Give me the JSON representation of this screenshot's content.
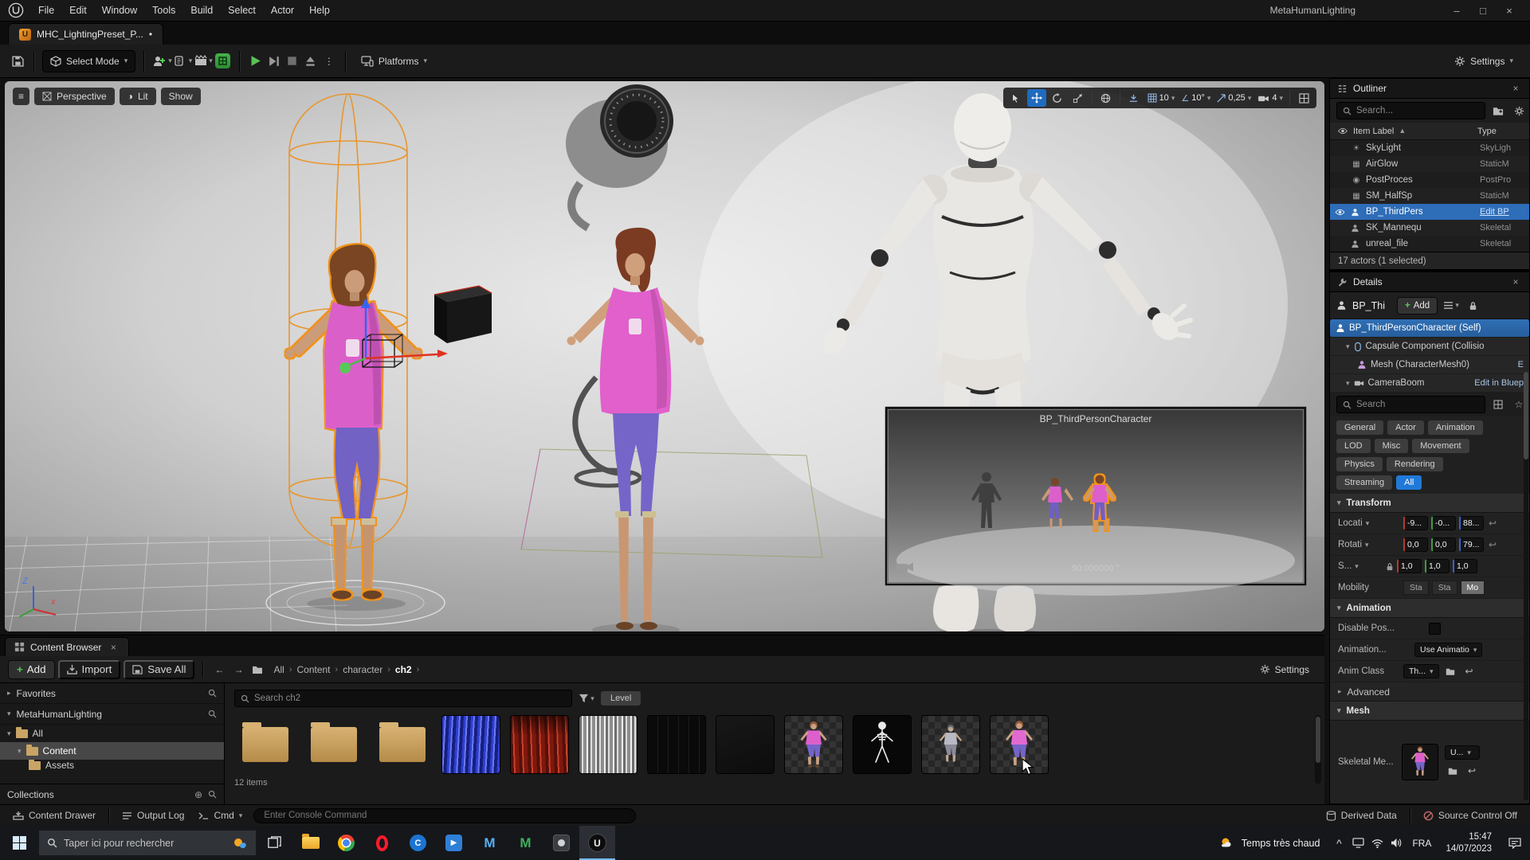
{
  "menubar": {
    "menus": [
      "File",
      "Edit",
      "Window",
      "Tools",
      "Build",
      "Select",
      "Actor",
      "Help"
    ],
    "window_title": "MetaHumanLighting",
    "minimize": "–",
    "maximize": "□",
    "close": "×"
  },
  "asset_tab": {
    "label": "MHC_LightingPreset_P...",
    "dirty": "•"
  },
  "toolbar": {
    "select_mode": "Select Mode",
    "platforms": "Platforms",
    "settings": "Settings"
  },
  "viewport": {
    "perspective": "Perspective",
    "lit": "Lit",
    "show": "Show",
    "grid_snap": "10",
    "angle_snap": "10°",
    "scale_snap": "0,25",
    "camera_speed": "4",
    "pip_title": "BP_ThirdPersonCharacter",
    "pip_rotation": "90.000000 °",
    "axis_z": "Z",
    "axis_x": "x"
  },
  "outliner": {
    "title": "Outliner",
    "close": "×",
    "search_placeholder": "Search...",
    "col_label": "Item Label",
    "col_sort": "▲",
    "col_type": "Type",
    "rows": [
      {
        "label": "SkyLight",
        "type": "SkyLigh"
      },
      {
        "label": "AirGlow",
        "type": "StaticM"
      },
      {
        "label": "PostProces",
        "type": "PostPro"
      },
      {
        "label": "SM_HalfSp",
        "type": "StaticM"
      },
      {
        "label": "BP_ThirdPers",
        "type": "Edit BP"
      },
      {
        "label": "SK_Mannequ",
        "type": "Skeletal"
      },
      {
        "label": "unreal_file",
        "type": "Skeletal"
      }
    ],
    "footer": "17 actors (1 selected)"
  },
  "details": {
    "title": "Details",
    "close": "×",
    "object_name": "BP_Thi",
    "add_button": "Add",
    "tree": [
      {
        "label": "BP_ThirdPersonCharacter (Self)",
        "trail": ""
      },
      {
        "label": "Capsule Component (Collisio",
        "trail": ""
      },
      {
        "label": "Mesh (CharacterMesh0)",
        "trail": "E"
      },
      {
        "label": "CameraBoom",
        "trail": "Edit in Bluep"
      }
    ],
    "search_placeholder": "Search",
    "filters": [
      "General",
      "Actor",
      "Animation",
      "LOD",
      "Misc",
      "Movement",
      "Physics",
      "Rendering",
      "Streaming",
      "All"
    ],
    "transform": {
      "title": "Transform",
      "location_label": "Locati",
      "location": [
        "-9...",
        "-0...",
        "88..."
      ],
      "rotation_label": "Rotati",
      "rotation": [
        "0,0",
        "0,0",
        "79..."
      ],
      "scale_label": "S...",
      "scale": [
        "1,0",
        "1,0",
        "1,0"
      ],
      "mobility_label": "Mobility",
      "mobility": [
        "Sta",
        "Sta",
        "Mo"
      ]
    },
    "animation": {
      "title": "Animation",
      "disable_label": "Disable Pos...",
      "mode_label": "Animation...",
      "mode_value": "Use Animatio",
      "class_label": "Anim Class",
      "class_value": "Th..."
    },
    "advanced_label": "Advanced",
    "mesh": {
      "title": "Mesh",
      "skeletal_label": "Skeletal Me...",
      "asset_value": "U..."
    }
  },
  "content_browser": {
    "tab": "Content Browser",
    "close": "×",
    "add_button": "Add",
    "import_button": "Import",
    "save_all_button": "Save All",
    "breadcrumbs": [
      "All",
      "Content",
      "character",
      "ch2"
    ],
    "settings": "Settings",
    "favorites": "Favorites",
    "project_root": "MetaHumanLighting",
    "tree_all": "All",
    "tree_content": "Content",
    "tree_assets": "Assets",
    "collections": "Collections",
    "search_placeholder": "Search ch2",
    "level_filter": "Level",
    "item_count": "12 items"
  },
  "statusbar": {
    "content_drawer": "Content Drawer",
    "output_log": "Output Log",
    "cmd": "Cmd",
    "console_placeholder": "Enter Console Command",
    "derived_data": "Derived Data",
    "source_control": "Source Control Off"
  },
  "taskbar": {
    "search_placeholder": "Taper ici pour rechercher",
    "weather": "Temps très chaud",
    "language": "FRA",
    "time": "15:47",
    "date": "14/07/2023"
  }
}
